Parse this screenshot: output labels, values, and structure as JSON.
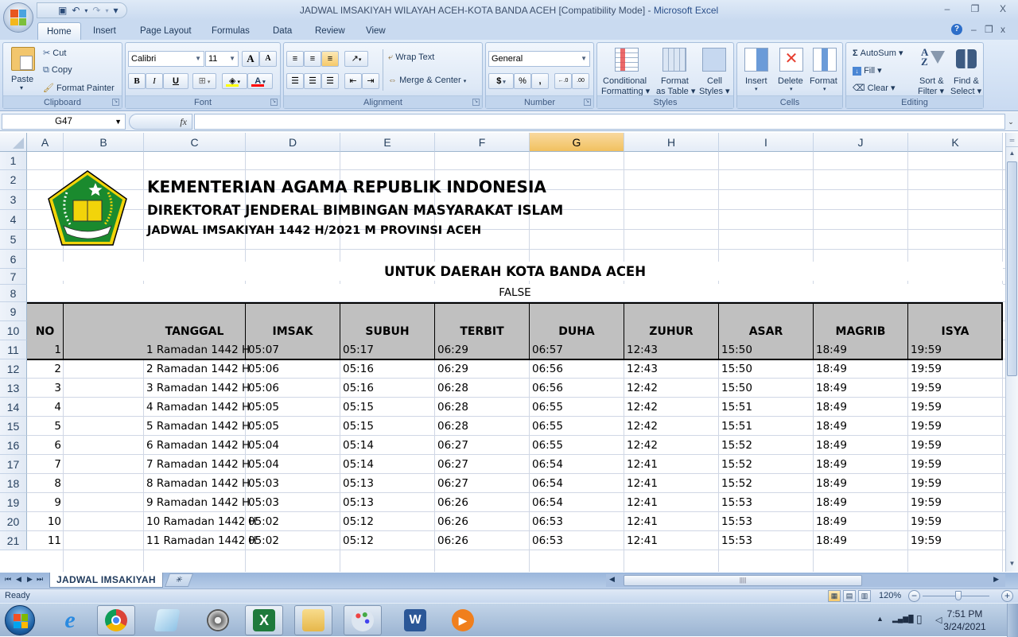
{
  "window": {
    "title_doc": "JADWAL IMSAKIYAH WILAYAH ACEH-KOTA BANDA ACEH  [Compatibility Mode] - ",
    "title_app": "Microsoft Excel",
    "minimize": "–",
    "restore": "❐",
    "close": "X"
  },
  "quick_access": {
    "save_icon": "💾",
    "undo_icon": "↶",
    "redo_icon": "↷",
    "customize_icon": "▾"
  },
  "tabs": [
    {
      "label": "Home",
      "active": true
    },
    {
      "label": "Insert"
    },
    {
      "label": "Page Layout"
    },
    {
      "label": "Formulas"
    },
    {
      "label": "Data"
    },
    {
      "label": "Review"
    },
    {
      "label": "View"
    }
  ],
  "help": {
    "icon": "?",
    "min": "–",
    "restore": "❐",
    "close": "x"
  },
  "ribbon": {
    "clipboard": {
      "label": "Clipboard",
      "paste": "Paste",
      "cut": "Cut",
      "copy": "Copy",
      "format_painter": "Format Painter"
    },
    "font": {
      "label": "Font",
      "font_name": "Calibri",
      "font_size": "11",
      "grow": "A",
      "shrink": "A",
      "bold": "B",
      "italic": "I",
      "underline": "U",
      "highlight_color": "#ffff00",
      "font_color": "#ff0000"
    },
    "alignment": {
      "label": "Alignment",
      "wrap_text": "Wrap Text",
      "merge_center": "Merge & Center"
    },
    "number": {
      "label": "Number",
      "format": "General",
      "currency": "$",
      "percent": "%",
      "comma": ",",
      "inc_decimal": "←.0 .00",
      "dec_decimal": ".00 →.0"
    },
    "styles": {
      "label": "Styles",
      "conditional_1": "Conditional",
      "conditional_2": "Formatting ▾",
      "table_1": "Format",
      "table_2": "as Table ▾",
      "cell_1": "Cell",
      "cell_2": "Styles ▾"
    },
    "cells": {
      "label": "Cells",
      "insert": "Insert",
      "delete": "Delete",
      "format": "Format"
    },
    "editing": {
      "label": "Editing",
      "autosum": "AutoSum ▾",
      "fill": "Fill ▾",
      "clear": "Clear ▾",
      "sort_1": "Sort &",
      "sort_2": "Filter ▾",
      "find_1": "Find &",
      "find_2": "Select ▾"
    }
  },
  "formula_bar": {
    "name_box": "G47",
    "fx": "fx",
    "formula": ""
  },
  "columns": [
    "A",
    "B",
    "C",
    "D",
    "E",
    "F",
    "G",
    "H",
    "I",
    "J",
    "K"
  ],
  "selected_column": "G",
  "rows": [
    "1",
    "2",
    "3",
    "4",
    "5",
    "6",
    "7",
    "8",
    "9",
    "10",
    "11",
    "12",
    "13",
    "14",
    "15",
    "16",
    "17",
    "18",
    "19",
    "20",
    "21"
  ],
  "sheet": {
    "title_1": "KEMENTERIAN AGAMA REPUBLIK INDONESIA",
    "title_2": "DIREKTORAT JENDERAL BIMBINGAN MASYARAKAT ISLAM",
    "title_3": "JADWAL IMSAKIYAH 1442 H/2021 M PROVINSI ACEH",
    "region": "UNTUK DAERAH KOTA BANDA ACEH",
    "flag": "FALSE",
    "logo_colors": {
      "green": "#1a8a2e",
      "gold": "#f2d40a"
    },
    "header_fill": "#c0c0c0",
    "headers": [
      "NO",
      "TANGGAL",
      "IMSAK",
      "SUBUH",
      "TERBIT",
      "DUHA",
      "ZUHUR",
      "ASAR",
      "MAGRIB",
      "ISYA"
    ],
    "schedule": [
      [
        "1",
        "1 Ramadan 1442 H",
        "05:07",
        "05:17",
        "06:29",
        "06:57",
        "12:43",
        "15:50",
        "18:49",
        "19:59"
      ],
      [
        "2",
        "2 Ramadan 1442 H",
        "05:06",
        "05:16",
        "06:29",
        "06:56",
        "12:43",
        "15:50",
        "18:49",
        "19:59"
      ],
      [
        "3",
        "3 Ramadan 1442 H",
        "05:06",
        "05:16",
        "06:28",
        "06:56",
        "12:42",
        "15:50",
        "18:49",
        "19:59"
      ],
      [
        "4",
        "4 Ramadan 1442 H",
        "05:05",
        "05:15",
        "06:28",
        "06:55",
        "12:42",
        "15:51",
        "18:49",
        "19:59"
      ],
      [
        "5",
        "5 Ramadan 1442 H",
        "05:05",
        "05:15",
        "06:28",
        "06:55",
        "12:42",
        "15:51",
        "18:49",
        "19:59"
      ],
      [
        "6",
        "6 Ramadan 1442 H",
        "05:04",
        "05:14",
        "06:27",
        "06:55",
        "12:42",
        "15:52",
        "18:49",
        "19:59"
      ],
      [
        "7",
        "7 Ramadan 1442 H",
        "05:04",
        "05:14",
        "06:27",
        "06:54",
        "12:41",
        "15:52",
        "18:49",
        "19:59"
      ],
      [
        "8",
        "8 Ramadan 1442 H",
        "05:03",
        "05:13",
        "06:27",
        "06:54",
        "12:41",
        "15:52",
        "18:49",
        "19:59"
      ],
      [
        "9",
        "9 Ramadan 1442 H",
        "05:03",
        "05:13",
        "06:26",
        "06:54",
        "12:41",
        "15:53",
        "18:49",
        "19:59"
      ],
      [
        "10",
        "10 Ramadan 1442 H",
        "05:02",
        "05:12",
        "06:26",
        "06:53",
        "12:41",
        "15:53",
        "18:49",
        "19:59"
      ],
      [
        "11",
        "11 Ramadan 1442 H",
        "05:02",
        "05:12",
        "06:26",
        "06:53",
        "12:41",
        "15:53",
        "18:49",
        "19:59"
      ]
    ]
  },
  "sheet_tabs": {
    "active": "JADWAL IMSAKIYAH",
    "nav": [
      "⏮",
      "◀",
      "▶",
      "⏭"
    ],
    "new_sheet_icon": "✳"
  },
  "status": {
    "text": "Ready",
    "zoom": "120%",
    "zoom_level_pct": 120,
    "zoom_minus": "−",
    "zoom_plus": "+"
  },
  "taskbar": {
    "apps": [
      "windows-start",
      "internet-explorer",
      "chrome",
      "notepad",
      "media-center",
      "excel",
      "windows-explorer",
      "paint",
      "word",
      "media-player"
    ],
    "time": "7:51 PM",
    "date": "3/24/2021",
    "tray": {
      "show_hidden": "▲",
      "signal": "▂▄▆█",
      "battery": "▯",
      "volume": "◁"
    }
  }
}
